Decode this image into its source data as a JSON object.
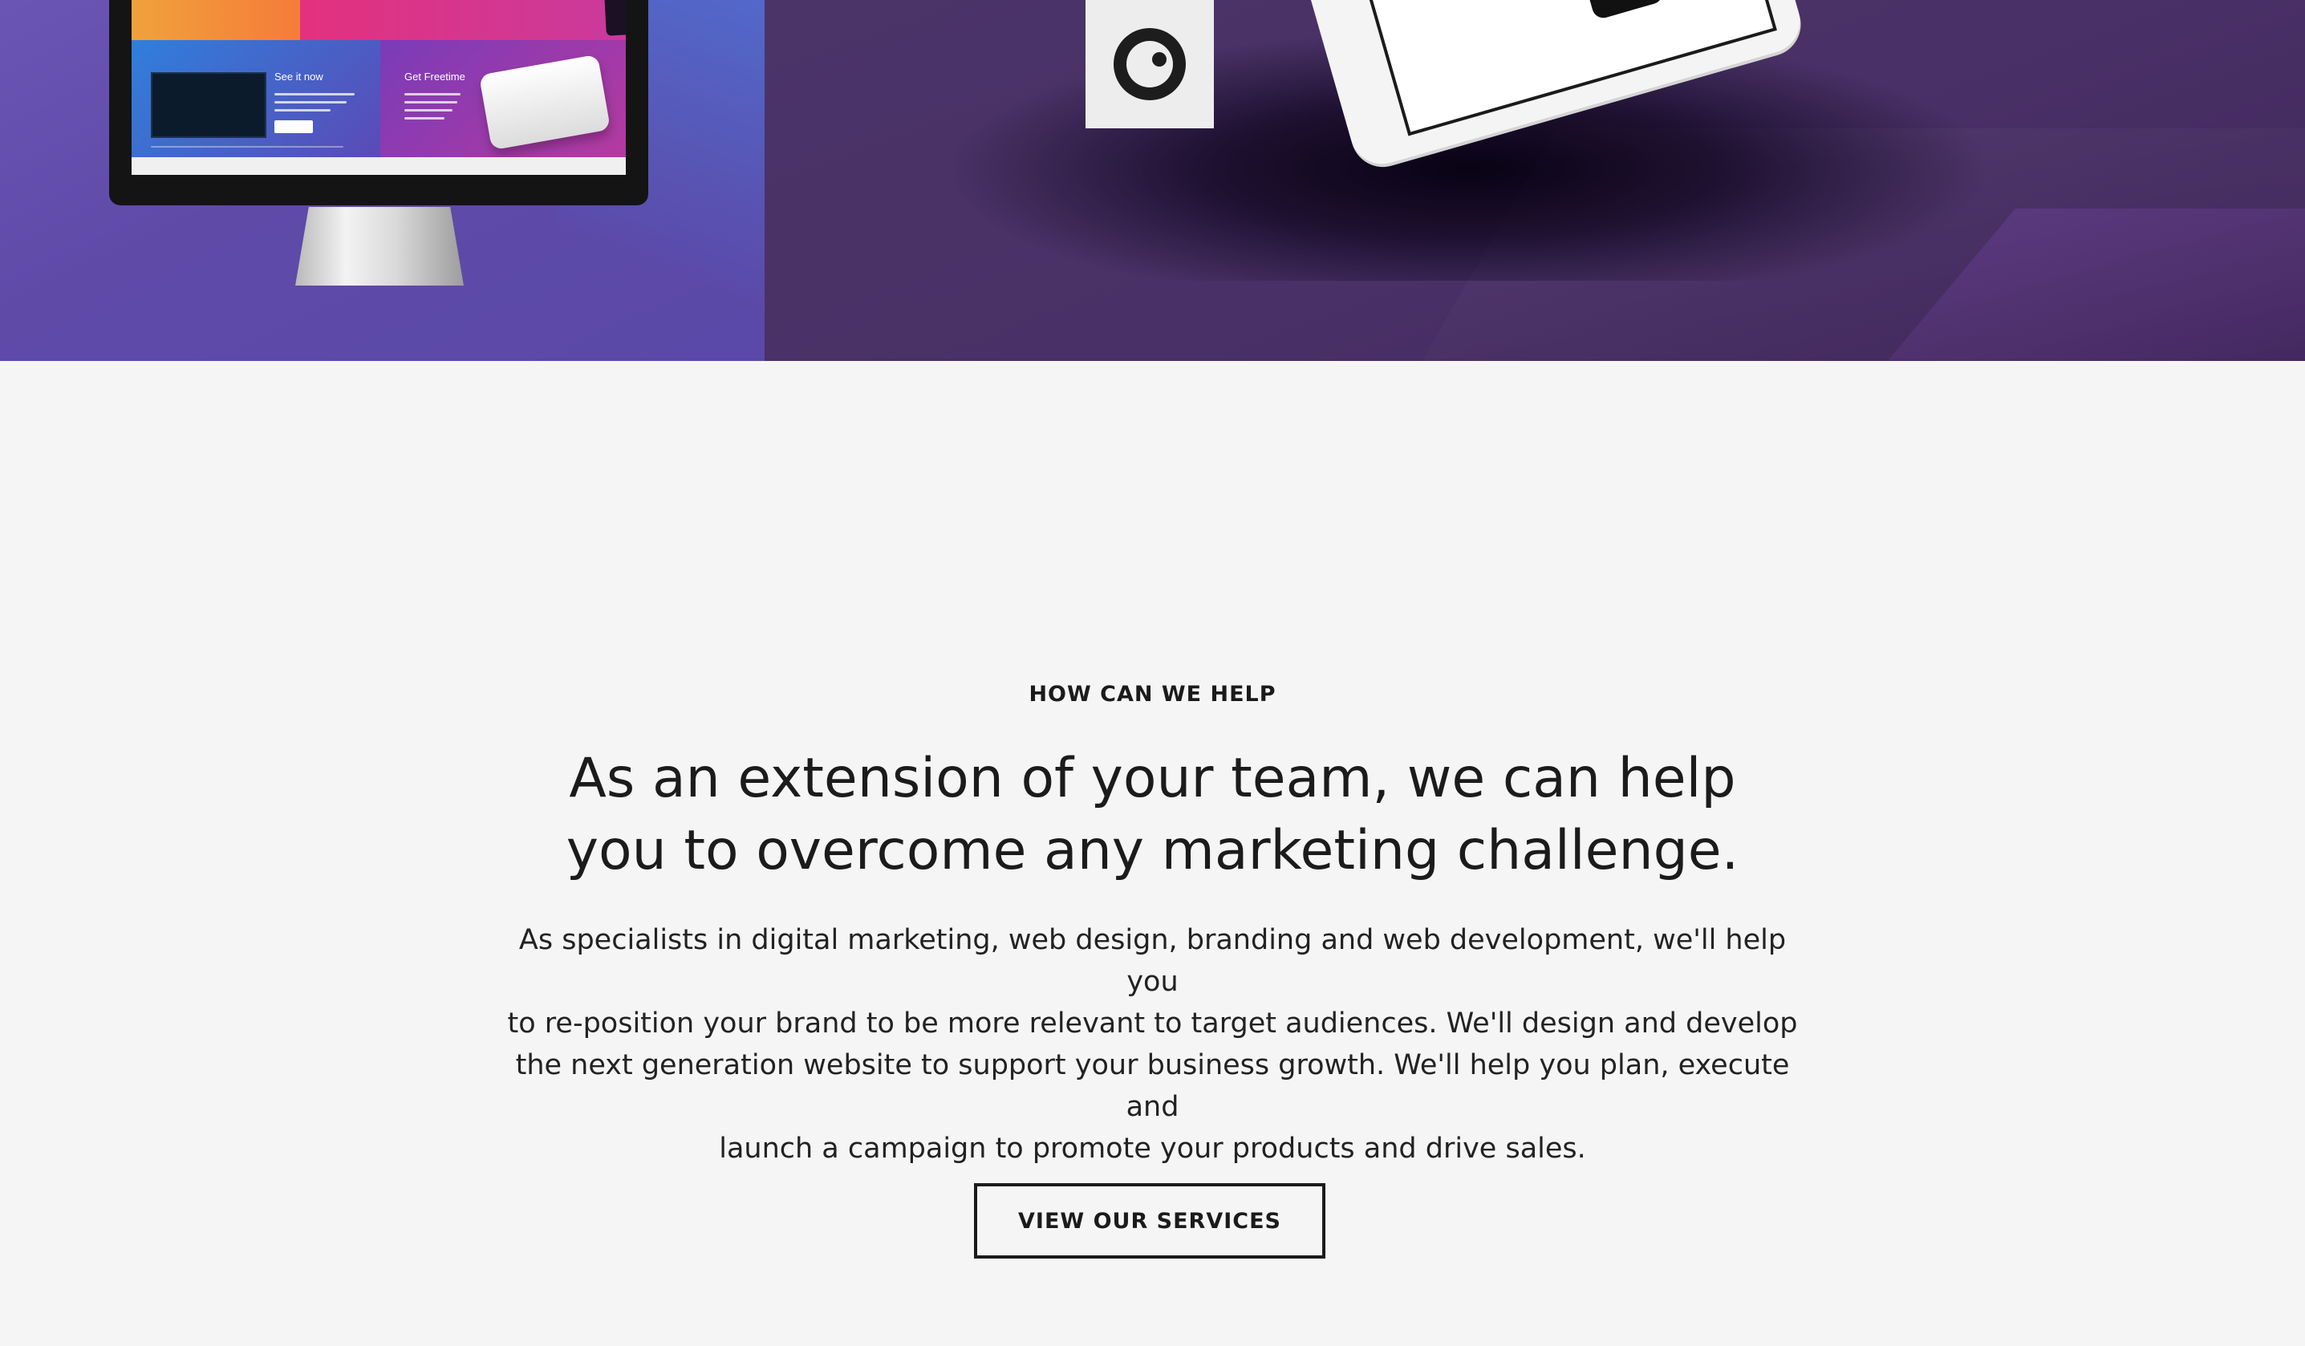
{
  "hero": {
    "monitor_screen": {
      "see_it_now": "See it now",
      "get_freetime": "Get Freetime"
    }
  },
  "help_section": {
    "eyebrow": "HOW CAN WE HELP",
    "headline_line1": "As an extension of your team, we can help",
    "headline_line2": "you to overcome any marketing challenge.",
    "body_line1": "As specialists in digital marketing, web design, branding and web development, we'll help you",
    "body_line2": "to re-position your brand to be more relevant to target audiences. We'll design and develop",
    "body_line3": "the next generation website to support your business growth. We'll help you plan, execute and",
    "body_line4": "launch a campaign to promote your products and drive sales.",
    "cta_label": "VIEW OUR SERVICES"
  },
  "colors": {
    "hero_left_purple": "#5f4aa8",
    "hero_right_purple": "#493066",
    "section_background": "#f5f5f5",
    "text_dark": "#1b1b1b"
  },
  "icons": [
    "brand-logo-icon"
  ]
}
